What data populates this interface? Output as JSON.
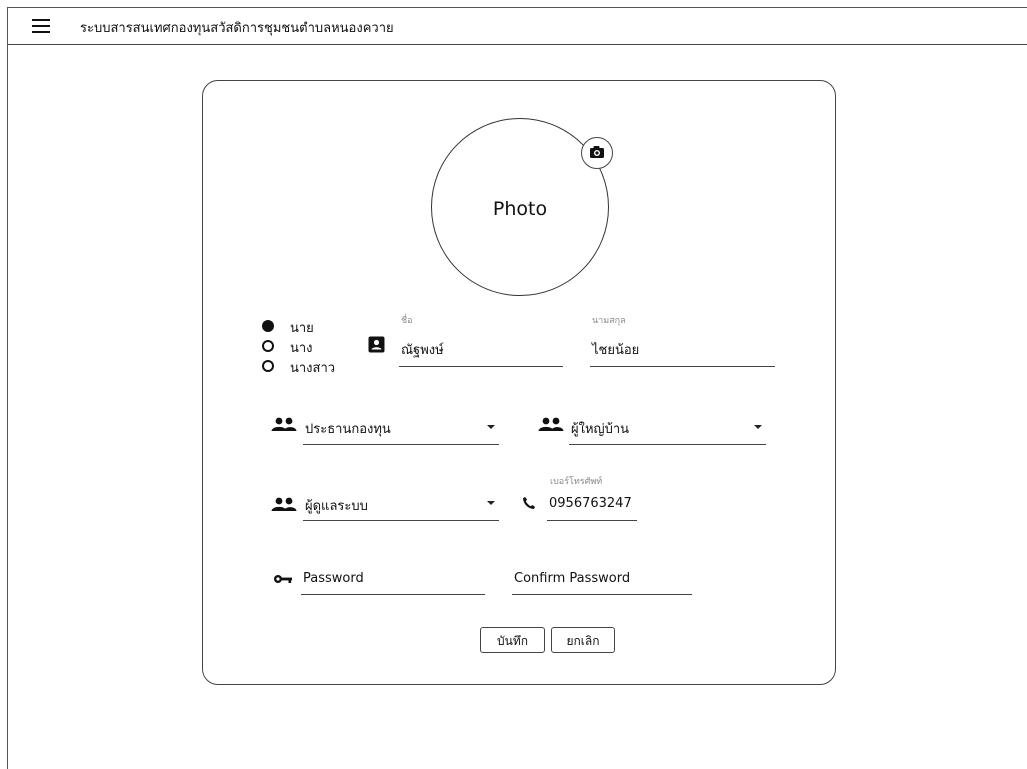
{
  "app": {
    "title": "ระบบสารสนเทศกองทุนสวัสดิการชุมชนตำบลหนองควาย"
  },
  "photo": {
    "label": "Photo"
  },
  "form": {
    "titles": [
      {
        "label": "นาย",
        "selected": true
      },
      {
        "label": "นาง",
        "selected": false
      },
      {
        "label": "นางสาว",
        "selected": false
      }
    ],
    "first_name": {
      "label": "ชื่อ",
      "value": "ณัฐพงษ์"
    },
    "last_name": {
      "label": "นามสกุล",
      "value": "ไชยน้อย"
    },
    "position": {
      "value": "ประธานกองทุน"
    },
    "elder": {
      "value": "ผู้ใหญ่บ้าน"
    },
    "role": {
      "value": "ผู้ดูแลระบบ"
    },
    "phone": {
      "label": "เบอร์โทรศัพท์",
      "value": "0956763247"
    },
    "password": {
      "placeholder": "Password"
    },
    "confirm_password": {
      "placeholder": "Confirm Password"
    }
  },
  "actions": {
    "save_label": "บันทึก",
    "cancel_label": "ยกเลิก"
  },
  "icons": {
    "menu": "hamburger-menu-icon",
    "camera": "camera-icon",
    "contact": "contact-card-icon",
    "people": "people-icon",
    "phone": "phone-icon",
    "key": "key-icon",
    "dropdown": "dropdown-arrow-icon"
  }
}
